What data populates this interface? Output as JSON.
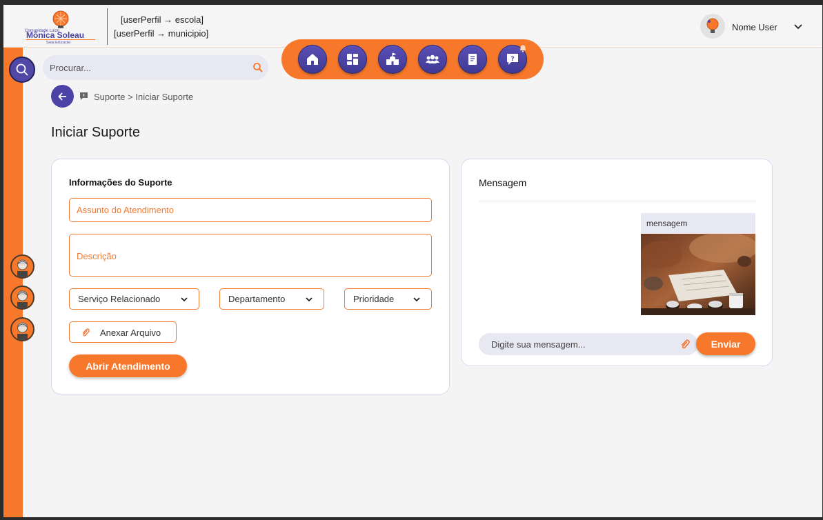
{
  "header": {
    "perfil_escola": "[userPerfil → escola]",
    "perfil_municipio": "[userPerfil → municipio]",
    "user_name": "Nome User",
    "logo_text_top": "Comunidade Luizo",
    "logo_text_main": "Mônica Soleau",
    "logo_text_sub": "Saga Educação"
  },
  "search": {
    "placeholder": "Procurar..."
  },
  "nav": {
    "items": [
      "home-icon",
      "dashboard-icon",
      "school-icon",
      "users-icon",
      "document-icon",
      "support-icon"
    ]
  },
  "breadcrumb": {
    "text": "Suporte > Iniciar Suporte"
  },
  "page": {
    "title": "Iniciar Suporte"
  },
  "form": {
    "section_title": "Informações do Suporte",
    "subject_placeholder": "Assunto do Atendimento",
    "description_placeholder": "Descrição",
    "select_service": "Serviço Relacionado",
    "select_department": "Departamento",
    "select_priority": "Prioridade",
    "attach_label": "Anexar Arquivo",
    "submit_label": "Abrir Atendimento"
  },
  "messages": {
    "title": "Mensagem",
    "bubble_text": "mensagem",
    "input_placeholder": "Digite sua mensagem...",
    "send_label": "Enviar"
  },
  "colors": {
    "accent": "#f7782a",
    "purple": "#4b44a6",
    "background": "#f4f4f4"
  }
}
